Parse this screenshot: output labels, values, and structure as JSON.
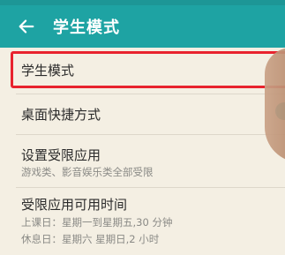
{
  "app_bar": {
    "title": "学生模式",
    "back_icon": "arrow-left-icon"
  },
  "rows": {
    "student_mode": {
      "title": "学生模式"
    },
    "desktop_shortcut": {
      "title": "桌面快捷方式",
      "toggle_on": true
    },
    "restricted_apps": {
      "title": "设置受限应用",
      "subtitle": "游戏类、影音娱乐类全部受限"
    },
    "available_time": {
      "title": "受限应用可用时间",
      "school_day": "上课日：星期一到星期五,30 分钟",
      "rest_day": "休息日：星期六 星期日,2 小时"
    }
  },
  "colors": {
    "accent": "#1ea3a3",
    "highlight": "#e8232e",
    "background": "#f4efe3"
  }
}
